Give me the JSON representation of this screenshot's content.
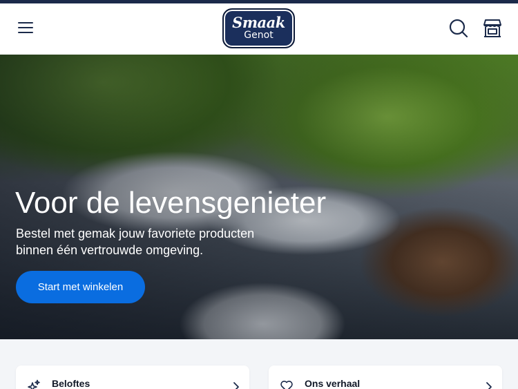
{
  "header": {
    "logo_line1": "Smaak",
    "logo_line2": "Genot"
  },
  "hero": {
    "title": "Voor de levensgenieter",
    "subtitle": "Bestel met gemak jouw favoriete producten binnen één vertrouwde omgeving.",
    "cta_label": "Start met winkelen"
  },
  "cards": [
    {
      "label": "Beloftes",
      "icon": "sparkle-icon"
    },
    {
      "label": "Ons verhaal",
      "icon": "heart-icon"
    }
  ],
  "colors": {
    "navy": "#1b2a4a",
    "cta_blue": "#0a6de0",
    "page_bg": "#f3f5f8"
  }
}
